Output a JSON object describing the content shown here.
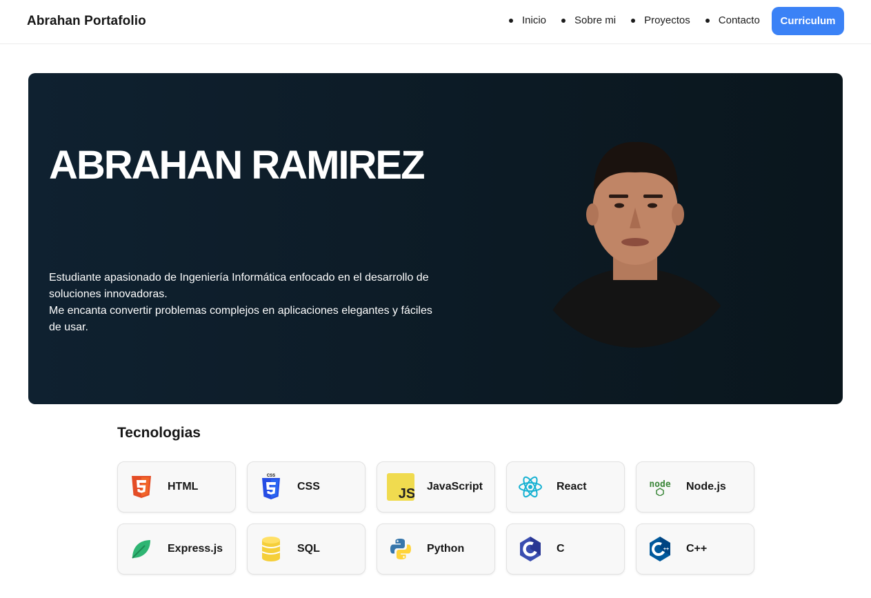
{
  "header": {
    "brand": "Abrahan Portafolio",
    "nav": [
      "Inicio",
      "Sobre mi",
      "Proyectos",
      "Contacto"
    ],
    "cv_button": "Curriculum"
  },
  "hero": {
    "name": "ABRAHAN RAMIREZ",
    "description": [
      "Estudiante apasionado de Ingeniería Informática enfocado en el desarrollo de soluciones innovadoras.",
      "Me encanta convertir problemas complejos en aplicaciones elegantes y fáciles de usar."
    ]
  },
  "technologies": {
    "title": "Tecnologias",
    "items": [
      {
        "label": "HTML",
        "icon": "html5-icon"
      },
      {
        "label": "CSS",
        "icon": "css3-icon"
      },
      {
        "label": "JavaScript",
        "icon": "javascript-icon"
      },
      {
        "label": "React",
        "icon": "react-icon"
      },
      {
        "label": "Node.js",
        "icon": "nodejs-icon"
      },
      {
        "label": "Express.js",
        "icon": "leaf-icon"
      },
      {
        "label": "SQL",
        "icon": "database-icon"
      },
      {
        "label": "Python",
        "icon": "python-icon"
      },
      {
        "label": "C",
        "icon": "c-icon"
      },
      {
        "label": "C++",
        "icon": "cplusplus-icon"
      }
    ]
  },
  "colors": {
    "accent": "#3b82f6",
    "hero_bg": "#0c1a24"
  }
}
